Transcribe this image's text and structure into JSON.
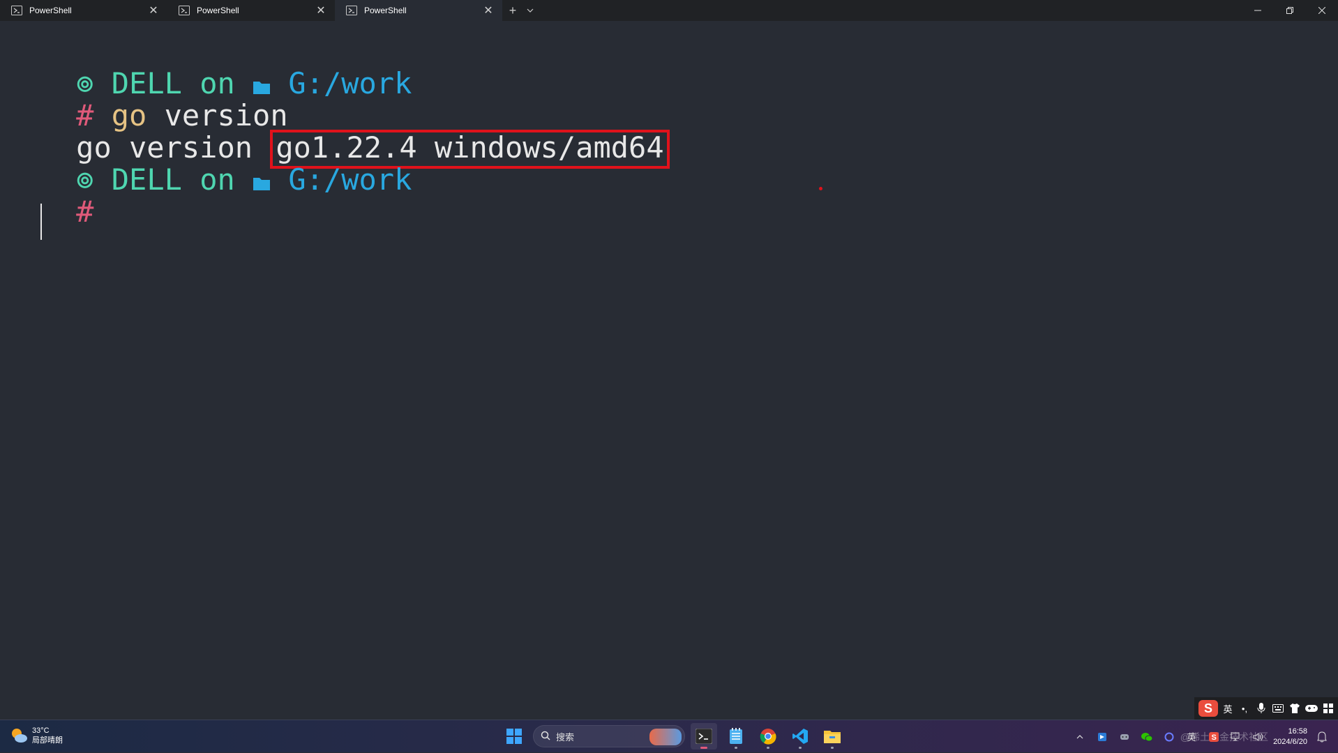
{
  "tabs": [
    {
      "label": "PowerShell",
      "active": false
    },
    {
      "label": "PowerShell",
      "active": false
    },
    {
      "label": "PowerShell",
      "active": true
    }
  ],
  "tabbar": {
    "new_tab": "+",
    "dropdown": "⌄"
  },
  "window_controls": {
    "minimize": "—",
    "restore": "❐",
    "close": "✕"
  },
  "terminal": {
    "prompt1": {
      "icon": "⊚",
      "user": "DELL",
      "on": "on",
      "folder_icon": "▰",
      "path": "G:/work"
    },
    "input1": {
      "hash": "#",
      "command": "go",
      "args": "version"
    },
    "output1": {
      "prefix": "go version ",
      "highlighted": "go1.22.4 windows/amd64"
    },
    "prompt2": {
      "icon": "⊚",
      "user": "DELL",
      "on": "on",
      "folder_icon": "▰",
      "path": "G:/work"
    },
    "input2": {
      "hash": "#"
    }
  },
  "ime": {
    "logo": "S",
    "lang": "英",
    "punct": "•,",
    "mic": "🎤",
    "keyboard": "⌨",
    "skin": "👕",
    "game": "🎮",
    "menu": "▦"
  },
  "taskbar": {
    "weather_temp": "33°C",
    "weather_desc": "局部晴朗",
    "search_placeholder": "搜索",
    "tray_chevron": "^",
    "tray_lang": "英",
    "clock_time": "16:58",
    "clock_date": "2024/6/20",
    "watermark": "@稀土掘金技术社区"
  },
  "colors": {
    "terminal_bg": "#282c34",
    "prompt_green": "#4fd6b0",
    "path_blue": "#29a8e0",
    "hash_pink": "#e05a7a",
    "command_yellow": "#e6c384",
    "highlight_red": "#e0121b"
  }
}
